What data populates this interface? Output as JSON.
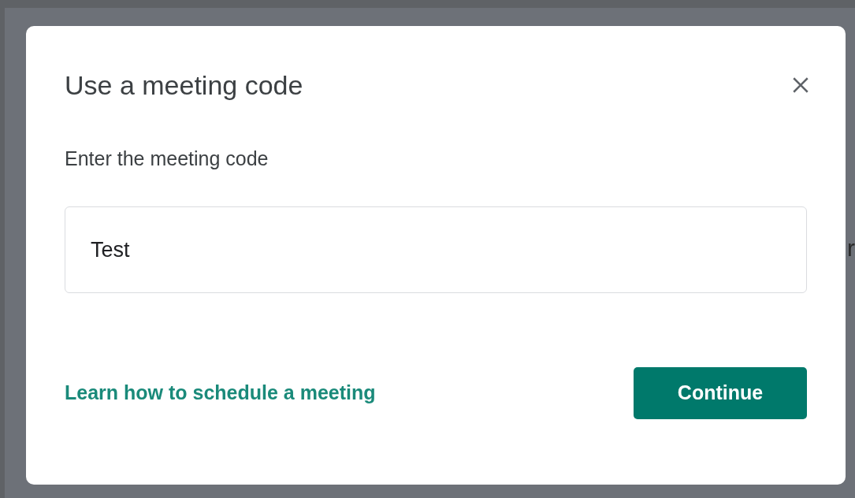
{
  "background_text": "r",
  "dialog": {
    "title": "Use a meeting code",
    "label": "Enter the meeting code",
    "input": {
      "value": "Test"
    },
    "link": "Learn how to schedule a meeting",
    "button": "Continue"
  }
}
